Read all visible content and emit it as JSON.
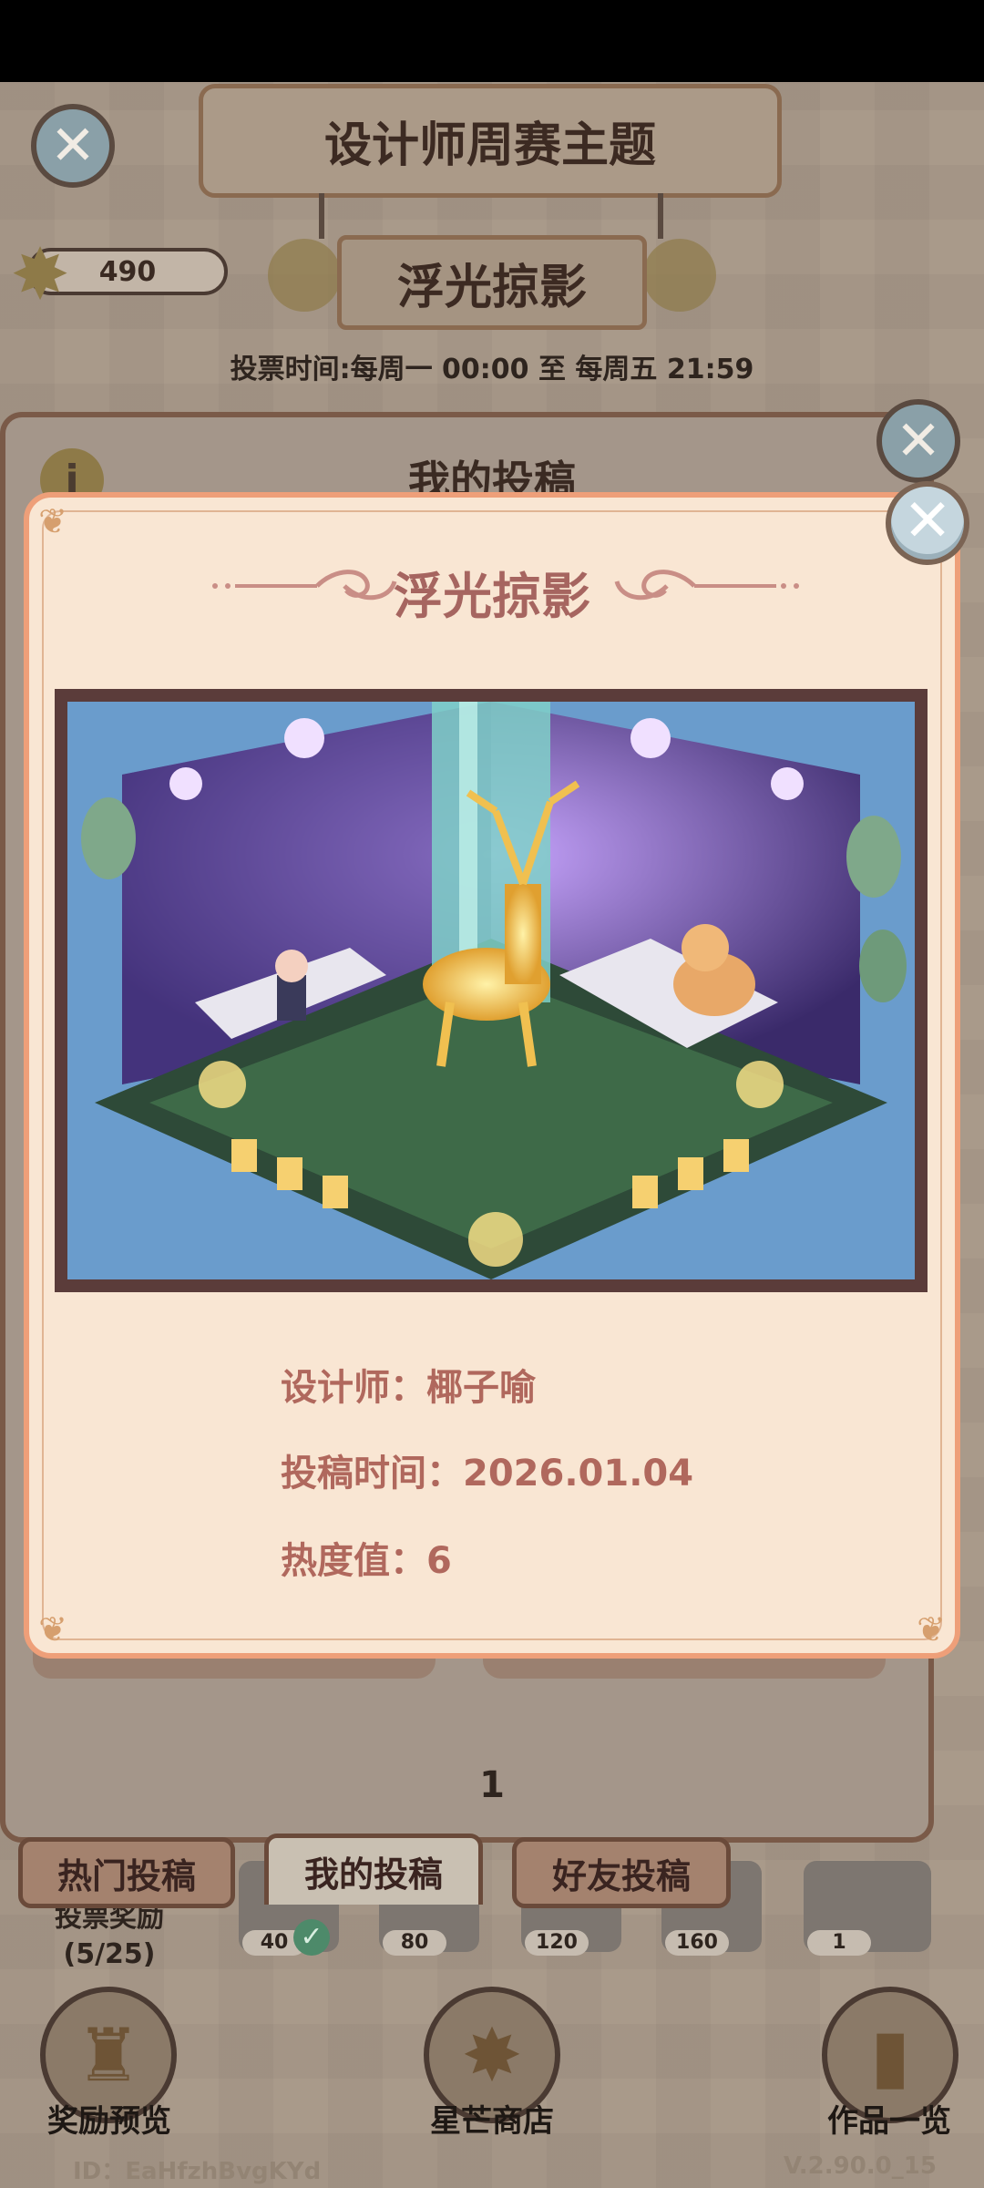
{
  "header": {
    "title": "设计师周赛主题",
    "theme_name": "浮光掠影",
    "vote_time": "投票时间:每周一 00:00 至 每周五 21:59"
  },
  "currency": {
    "stars": "490"
  },
  "panel": {
    "title": "我的投稿",
    "page": "1"
  },
  "tabs": [
    {
      "label": "热门投稿"
    },
    {
      "label": "我的投稿"
    },
    {
      "label": "好友投稿"
    }
  ],
  "rewards": {
    "label_line1": "投票奖励",
    "label_line2": "(5/25)",
    "milestones": [
      "40",
      "80",
      "120",
      "160",
      "1"
    ]
  },
  "bottom_buttons": [
    {
      "label": "奖励预览",
      "icon": "trophy-icon"
    },
    {
      "label": "星芒商店",
      "icon": "star-icon"
    },
    {
      "label": "作品一览",
      "icon": "book-icon"
    }
  ],
  "footer": {
    "player_id": "ID：EaHfzhBvgKYd",
    "version": "V.2.90.0_15"
  },
  "modal": {
    "title": "浮光掠影",
    "designer_label": "设计师：",
    "designer": "椰子喻",
    "submit_label": "投稿时间：",
    "submit_date": "2026.01.04",
    "heat_label": "热度值：",
    "heat": "6"
  },
  "colors": {
    "modal_bg": "#f9e6d3",
    "modal_border": "#ee9f79",
    "accent_text": "#b0685d"
  }
}
